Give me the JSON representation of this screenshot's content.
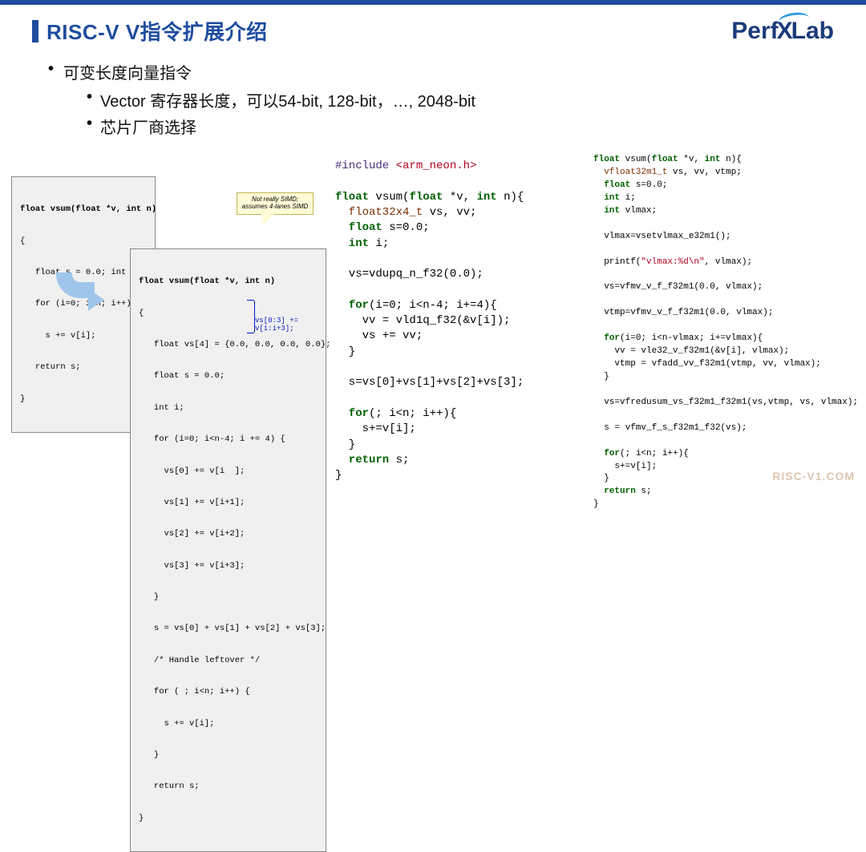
{
  "header": {
    "title": "RISC-V V指令扩展介绍",
    "logo_perf": "Perf",
    "logo_x": "X",
    "logo_lab": "Lab"
  },
  "bullets": {
    "l1": "可变长度向量指令",
    "l2a": "Vector 寄存器长度，可以54-bit, 128-bit，…, 2048-bit",
    "l2b": "芯片厂商选择"
  },
  "callout": {
    "line1": "Not really SIMD;",
    "line2": "assumes 4-lanes SIMD"
  },
  "annot": "vs[0:3] += v[i:i+3];",
  "code_scalar": {
    "l1": "float vsum(float *v, int n)",
    "l2": "{",
    "l3": "   float s = 0.0; int i;",
    "l4": "   for (i=0; i<n; i++)",
    "l5": "     s += v[i];",
    "l6": "   return s;",
    "l7": "}"
  },
  "code_unroll": {
    "l1": "float vsum(float *v, int n)",
    "l2": "{",
    "l3": "   float vs[4] = {0.0, 0.0, 0.0, 0.0};",
    "l4": "   float s = 0.0;",
    "l5": "   int i;",
    "l6": "   for (i=0; i<n-4; i += 4) {",
    "l7": "     vs[0] += v[i  ];",
    "l8": "     vs[1] += v[i+1];",
    "l9": "     vs[2] += v[i+2];",
    "l10": "     vs[3] += v[i+3];",
    "l11": "   }",
    "l12": "   s = vs[0] + vs[1] + vs[2] + vs[3];",
    "l13": "   /* Handle leftover */",
    "l14": "   for ( ; i<n; i++) {",
    "l15": "     s += v[i];",
    "l16": "   }",
    "l17": "   return s;",
    "l18": "}"
  },
  "neon": {
    "inc_hash": "#include ",
    "inc_hdr": "<arm_neon.h>",
    "l1a": "float",
    "l1b": " vsum(",
    "l1c": "float",
    "l1d": " *v, ",
    "l1e": "int",
    "l1f": " n){",
    "l2a": "  float32x4_t",
    "l2b": " vs, vv;",
    "l3a": "  float",
    "l3b": " s=",
    "l3c": "0.0",
    "l3d": ";",
    "l4a": "  int",
    "l4b": " i;",
    "l5": "  vs=vdupq_n_f32(0.0);",
    "l6a": "  for",
    "l6b": "(i=0; i<n-4; i+=4){",
    "l7": "    vv = vld1q_f32(&v[i]);",
    "l8": "    vs += vv;",
    "l9": "  }",
    "l10": "  s=vs[0]+vs[1]+vs[2]+vs[3];",
    "l11a": "  for",
    "l11b": "(; i<n; i++){",
    "l12": "    s+=v[i];",
    "l13": "  }",
    "l14a": "  return",
    "l14b": " s;",
    "l15": "}"
  },
  "riscv": {
    "l1a": "float",
    "l1b": " vsum(",
    "l1c": "float",
    "l1d": " *v, ",
    "l1e": "int",
    "l1f": " n){",
    "l2a": "  vfloat32m1_t",
    "l2b": " vs, vv, vtmp;",
    "l3a": "  float",
    "l3b": " s=",
    "l3c": "0.0",
    "l3d": ";",
    "l4a": "  int",
    "l4b": " i;",
    "l5a": "  int",
    "l5b": " vlmax;",
    "l6": "  vlmax=vsetvlmax_e32m1();",
    "l7a": "  printf(",
    "l7b": "\"vlmax:%d\\n\"",
    "l7c": ", vlmax);",
    "l8": "  vs=vfmv_v_f_f32m1(0.0, vlmax);",
    "l9": "  vtmp=vfmv_v_f_f32m1(0.0, vlmax);",
    "l10a": "  for",
    "l10b": "(i=0; i<n-vlmax; i+=vlmax){",
    "l11": "    vv = vle32_v_f32m1(&v[i], vlmax);",
    "l12": "    vtmp = vfadd_vv_f32m1(vtmp, vv, vlmax);",
    "l13": "  }",
    "l14": "  vs=vfredusum_vs_f32m1_f32m1(vs,vtmp, vs, vlmax);",
    "l15": "  s = vfmv_f_s_f32m1_f32(vs);",
    "l16a": "  for",
    "l16b": "(; i<n; i++){",
    "l17": "    s+=v[i];",
    "l18": "  }",
    "l19a": "  return",
    "l19b": " s;",
    "l20": "}"
  },
  "watermark": "RISC-V1.COM"
}
